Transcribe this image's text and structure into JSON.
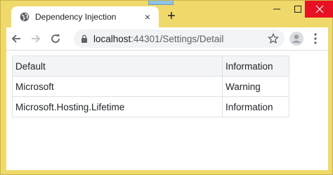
{
  "tab": {
    "title": "Dependency Injection",
    "close": "×"
  },
  "new_tab": "+",
  "address": {
    "host": "localhost",
    "rest": ":44301/Settings/Detail"
  },
  "table": {
    "headers": [
      "Default",
      "Information"
    ],
    "rows": [
      {
        "name": "Microsoft",
        "level": "Warning"
      },
      {
        "name": "Microsoft.Hosting.Lifetime",
        "level": "Information"
      }
    ]
  },
  "colors": {
    "frame": "#f0d96b",
    "close_button": "#e81123",
    "omnibox": "#f1f3f4"
  },
  "icons": [
    "globe-icon",
    "close-icon",
    "plus-icon",
    "minimize-icon",
    "maximize-icon",
    "window-close-icon",
    "back-arrow-icon",
    "forward-arrow-icon",
    "reload-icon",
    "lock-icon",
    "star-icon",
    "profile-icon",
    "kebab-menu-icon"
  ]
}
